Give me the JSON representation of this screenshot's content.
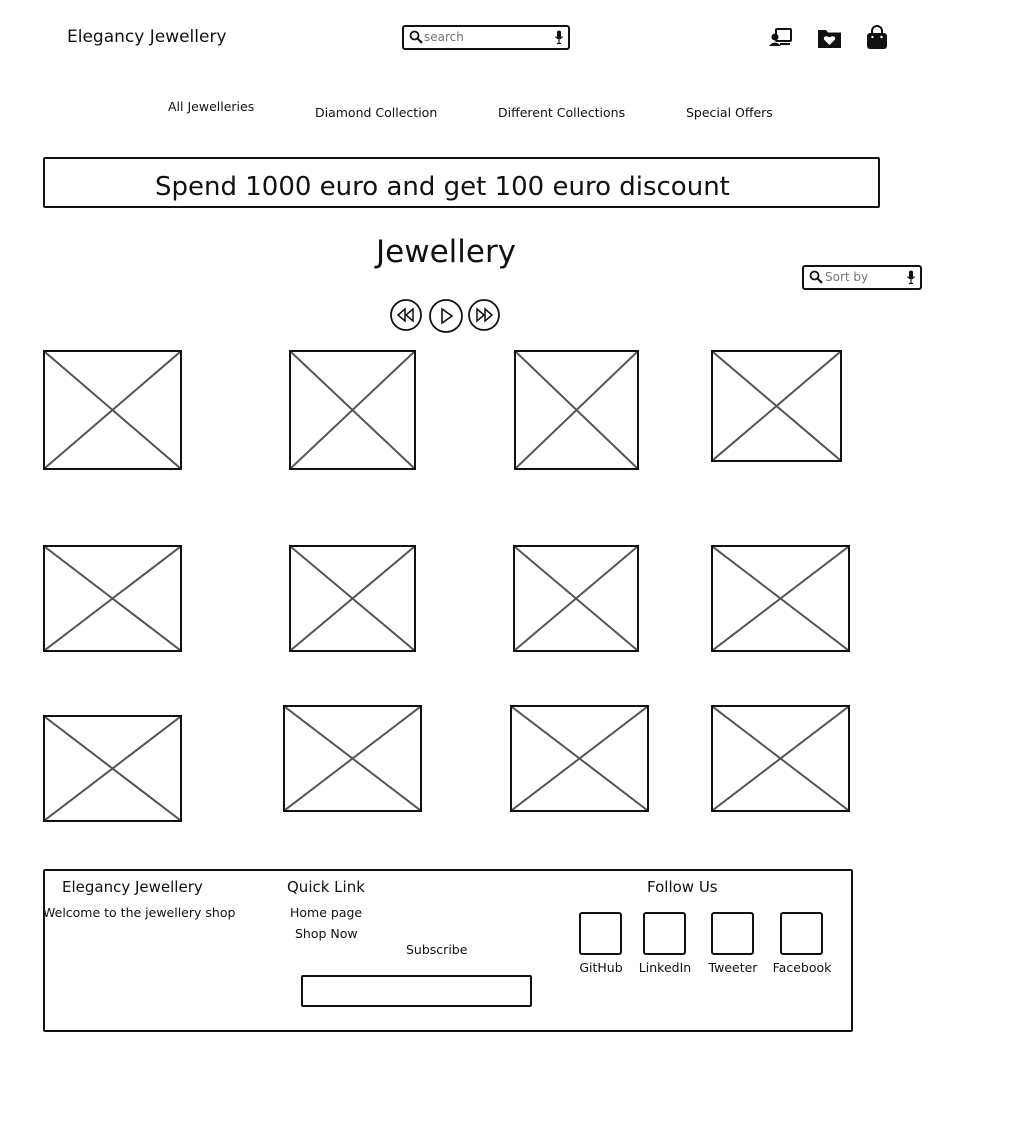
{
  "header": {
    "brand": "Elegancy Jewellery",
    "search_placeholder": "search",
    "icons": [
      "account-icon",
      "wishlist-icon",
      "shopping-bag-icon"
    ]
  },
  "nav": {
    "items": [
      "All Jewelleries",
      "Diamond Collection",
      "Different Collections",
      "Special Offers"
    ]
  },
  "banner": {
    "text": "Spend 1000 euro and get 100 euro discount"
  },
  "main": {
    "title": "Jewellery",
    "sort_placeholder": "Sort by",
    "media_controls": [
      "rewind-icon",
      "play-icon",
      "fast-forward-icon"
    ],
    "products_count": 12
  },
  "footer": {
    "brand": "Elegancy Jewellery",
    "tagline": "Welcome to the jewellery shop",
    "quick_link_title": "Quick Link",
    "links": [
      "Home page",
      "Shop Now"
    ],
    "subscribe_label": "Subscribe",
    "follow_title": "Follow Us",
    "social": [
      "GitHub",
      "LinkedIn",
      "Tweeter",
      "Facebook"
    ]
  },
  "colors": {
    "ink": "#111111",
    "placeholder_text": "#888888",
    "image_cross": "#555555"
  }
}
